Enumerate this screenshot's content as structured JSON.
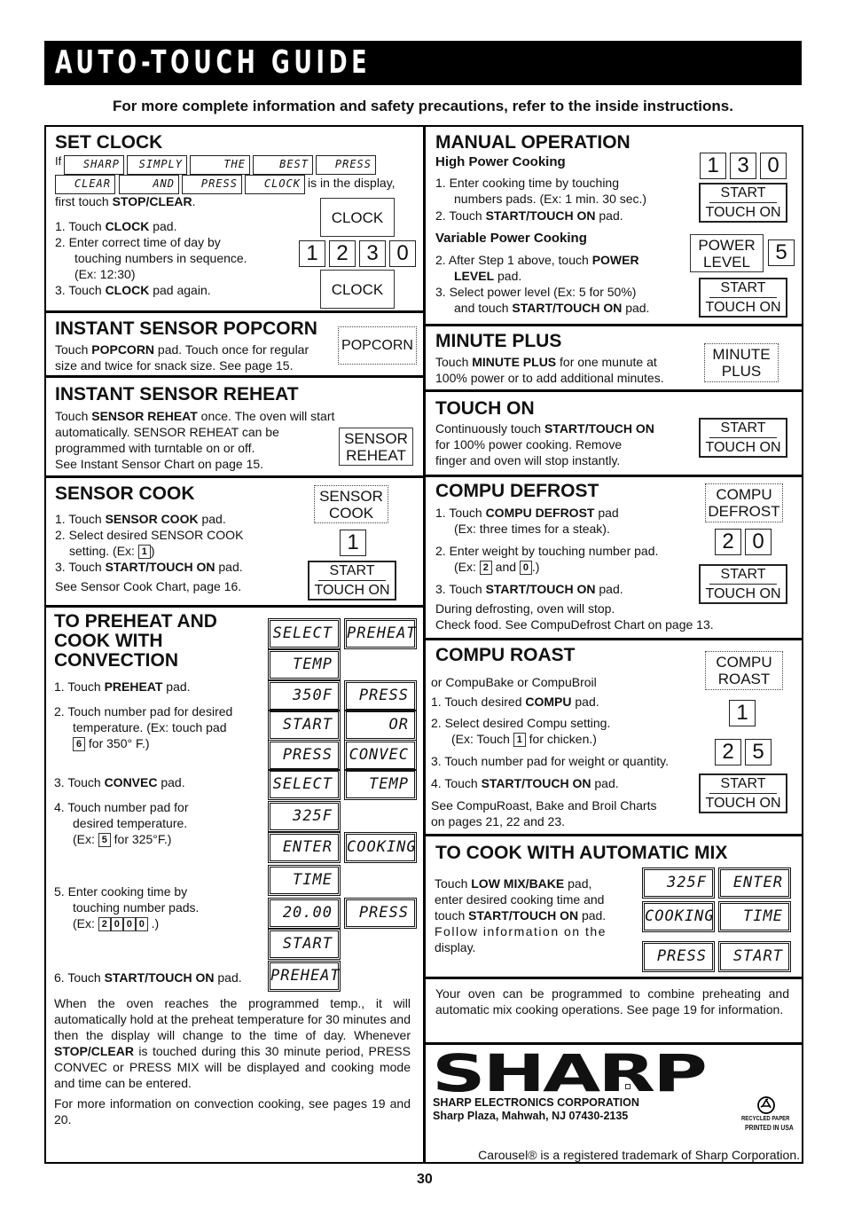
{
  "header": {
    "title": "AUTO-TOUCH GUIDE",
    "subtitle": "For more complete information and safety precautions, refer to the inside instructions."
  },
  "set_clock": {
    "title": "SET CLOCK",
    "if_label": "If",
    "display_words": [
      "SHARP",
      "SIMPLY",
      "THE",
      "BEST",
      "PRESS",
      "CLEAR",
      "AND",
      "PRESS",
      "CLOCK"
    ],
    "in_display": "is in the display,",
    "first_touch_pre": "first touch ",
    "first_touch_key": "STOP/CLEAR",
    "first_touch_post": ".",
    "step1_pre": "1. Touch ",
    "step1_key": "CLOCK",
    "step1_post": " pad.",
    "step2_a": "2. Enter correct time of day by",
    "step2_b": "touching numbers in sequence.",
    "step2_c": "(Ex: 12:30)",
    "step3_pre": "3. Touch ",
    "step3_key": "CLOCK",
    "step3_post": " pad again.",
    "pad_clock": "CLOCK",
    "digits": [
      "1",
      "2",
      "3",
      "0"
    ]
  },
  "popcorn": {
    "title": "INSTANT SENSOR POPCORN",
    "text_pre": "Touch ",
    "text_key": "POPCORN",
    "text_post": " pad. Touch once for regular",
    "text2": "size and twice for snack size. See page 15.",
    "pad": "POPCORN"
  },
  "reheat": {
    "title": "INSTANT SENSOR REHEAT",
    "l1_pre": "Touch ",
    "l1_key": "SENSOR REHEAT",
    "l1_post": " once. The oven will start",
    "l2": "automatically. SENSOR REHEAT can be",
    "l3": "programmed with turntable on or off.",
    "l4": "See Instant Sensor Chart on page 15.",
    "pad_l1": "SENSOR",
    "pad_l2": "REHEAT"
  },
  "sensor_cook": {
    "title": "SENSOR COOK",
    "s1_pre": "1. Touch ",
    "s1_key": "SENSOR COOK",
    "s1_post": " pad.",
    "s2a": "2. Select desired SENSOR COOK",
    "s2b_pre": "setting. (Ex: ",
    "s2b_key": "1",
    "s2b_post": ")",
    "s3_pre": "3. Touch ",
    "s3_key": "START/TOUCH ON",
    "s3_post": " pad.",
    "note": "See Sensor Cook Chart, page 16.",
    "pad_l1": "SENSOR",
    "pad_l2": "COOK",
    "digit": "1",
    "start_a": "START",
    "start_b": "TOUCH ON"
  },
  "preheat": {
    "title_l1": "TO PREHEAT AND",
    "title_l2": "COOK WITH",
    "title_l3": "CONVECTION",
    "s1_pre": "1.  Touch ",
    "s1_key": "PREHEAT",
    "s1_post": " pad.",
    "s2a": "2.  Touch number pad for desired",
    "s2b": "temperature. (Ex: touch pad",
    "s2c_key": "6",
    "s2c_post": " for 350° F.)",
    "s3_pre": "3.  Touch ",
    "s3_key": "CONVEC",
    "s3_post": " pad.",
    "s4a": "4.  Touch number pad for",
    "s4b": "desired temperature.",
    "s4c_pre": "(Ex: ",
    "s4c_key": "5",
    "s4c_post": " for 325°F.)",
    "s5a": "5.  Enter cooking time by",
    "s5b": "touching number pads.",
    "s5c_pre": "(Ex: ",
    "s5c_keys": [
      "2",
      "0",
      "0",
      "0"
    ],
    "s5c_post": " .)",
    "s6_pre": "6.  Touch ",
    "s6_key": "START/TOUCH ON",
    "s6_post": " pad.",
    "lcd": [
      "SELECT",
      "PREHEAT",
      "TEMP",
      "350F",
      "PRESS",
      "START",
      "OR",
      "PRESS",
      "CONVEC",
      "SELECT",
      "TEMP",
      "325F",
      "ENTER",
      "COOKING",
      "TIME",
      "20.00",
      "PRESS",
      "START",
      "PREHEAT"
    ],
    "para1_a": "When the oven reaches the programmed temp., it will automatically hold at the preheat temperature for 30 minutes and then the display will change to the time of day. Whenever ",
    "para1_key": "STOP/CLEAR",
    "para1_b": " is touched during this 30 minute period, PRESS CONVEC or PRESS MIX will be displayed and cooking mode and time can be entered.",
    "para2": "For more information on convection cooking, see pages 19 and 20."
  },
  "manual": {
    "title": "MANUAL OPERATION",
    "high_title": "High Power Cooking",
    "h1a": "1.  Enter cooking time by touching",
    "h1b": "numbers pads. (Ex: 1 min. 30 sec.)",
    "h2_pre": "2.  Touch ",
    "h2_key": "START/TOUCH ON",
    "h2_post": " pad.",
    "var_title": "Variable Power Cooking",
    "v2a_pre": "2.  After Step 1 above, touch ",
    "v2a_key": "POWER",
    "v2b_key": "LEVEL",
    "v2b_post": " pad.",
    "v3a": "3.  Select power level (Ex: 5 for 50%)",
    "v3b_pre": "and touch ",
    "v3b_key": "START/TOUCH ON",
    "v3b_post": " pad.",
    "digits": [
      "1",
      "3",
      "0"
    ],
    "power_l1": "POWER",
    "power_l2": "LEVEL",
    "power_digit": "5",
    "start_a": "START",
    "start_b": "TOUCH ON"
  },
  "minute_plus": {
    "title": "MINUTE PLUS",
    "l1_pre": "Touch ",
    "l1_key": "MINUTE PLUS",
    "l1_post": " for one munute at",
    "l2": "100% power or to add additional minutes.",
    "pad_l1": "MINUTE",
    "pad_l2": "PLUS"
  },
  "touch_on": {
    "title": "TOUCH ON",
    "l1_pre": "Continuously touch ",
    "l1_key": "START/TOUCH ON",
    "l2": "for 100%  power cooking. Remove",
    "l3": "finger and oven will stop instantly.",
    "start_a": "START",
    "start_b": "TOUCH ON"
  },
  "defrost": {
    "title": "COMPU DEFROST",
    "s1_pre": "1.  Touch ",
    "s1_key": "COMPU DEFROST",
    "s1_post": " pad",
    "s1b": "(Ex: three times for a steak).",
    "s2a": "2.  Enter weight by touching number pad.",
    "s2b_pre": "(Ex: ",
    "s2b_k1": "2",
    "s2b_mid": "  and ",
    "s2b_k2": "0",
    "s2b_post": ".)",
    "s3_pre": "3.  Touch ",
    "s3_key": "START/TOUCH ON",
    "s3_post": " pad.",
    "n1": "During defrosting, oven will stop.",
    "n2": "Check food. See CompuDefrost Chart on page 13.",
    "pad_l1": "COMPU",
    "pad_l2": "DEFROST",
    "digits": [
      "2",
      "0"
    ],
    "start_a": "START",
    "start_b": "TOUCH ON"
  },
  "roast": {
    "title": "COMPU ROAST",
    "sub": "or CompuBake or CompuBroil",
    "s1_pre": "1.  Touch desired ",
    "s1_key": "COMPU",
    "s1_post": " pad.",
    "s2a": "2.  Select desired Compu setting.",
    "s2b_pre": "(Ex: Touch ",
    "s2b_key": "1",
    "s2b_post": " for chicken.)",
    "s3": "3.  Touch number pad for weight or quantity.",
    "s4_pre": "4.  Touch ",
    "s4_key": "START/TOUCH ON",
    "s4_post": " pad.",
    "n1": "See CompuRoast, Bake and Broil Charts",
    "n2": "on pages 21, 22 and 23.",
    "pad_l1": "COMPU",
    "pad_l2": "ROAST",
    "digit": "1",
    "digits": [
      "2",
      "5"
    ],
    "start_a": "START",
    "start_b": "TOUCH ON"
  },
  "mix": {
    "title": "TO COOK WITH AUTOMATIC MIX",
    "l1_pre": "Touch ",
    "l1_key": "LOW MIX/BAKE",
    "l1_post": " pad,",
    "l2": "enter desired cooking time and",
    "l3_pre": "touch ",
    "l3_key": "START/TOUCH ON",
    "l3_post": " pad.",
    "l4": "Follow information on the",
    "l5": "display.",
    "lcd": [
      "325F",
      "ENTER",
      "COOKING",
      "TIME",
      "PRESS",
      "START"
    ],
    "note": "Your oven can be programmed to combine preheating and automatic mix cooking operations. See page 19 for information."
  },
  "footer": {
    "logo": "SHARP",
    "company": "SHARP ELECTRONICS CORPORATION",
    "address": "Sharp Plaza, Mahwah, NJ 07430-2135",
    "recycled": "RECYCLED PAPER",
    "printed": "PRINTED IN USA",
    "trademark": "Carousel® is a registered trademark of Sharp Corporation.",
    "page_number": "30"
  }
}
